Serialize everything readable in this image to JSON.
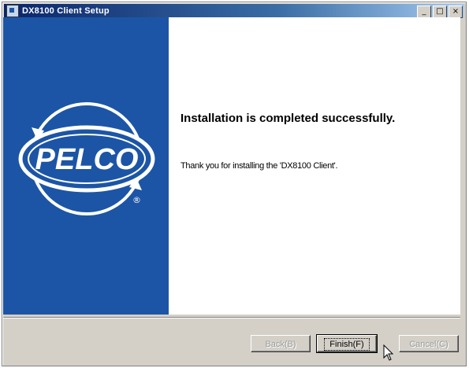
{
  "window": {
    "title": "DX8100 Client Setup",
    "controls": {
      "minimize": "_",
      "maximize": "□",
      "close": "×"
    }
  },
  "logo": {
    "text": "PELCO",
    "registered": "®"
  },
  "main": {
    "heading": "Installation is completed successfully.",
    "message": "Thank you for installing the 'DX8100 Client'."
  },
  "buttons": {
    "back": "Back(B)",
    "finish": "Finish(F)",
    "cancel": "Cancel(C)"
  },
  "colors": {
    "panel": "#1c55a5",
    "title_start": "#0a246a",
    "title_end": "#a6caf0"
  }
}
